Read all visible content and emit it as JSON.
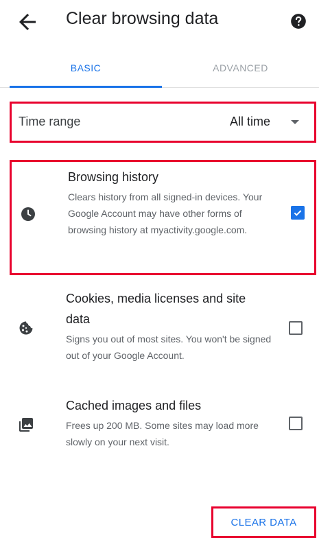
{
  "appbar": {
    "title": "Clear browsing data",
    "back_icon": "arrow-left-icon",
    "help_icon": "help-circle-icon"
  },
  "tabs": [
    {
      "label": "BASIC",
      "selected": true
    },
    {
      "label": "ADVANCED",
      "selected": false
    }
  ],
  "time_range": {
    "label": "Time range",
    "value": "All time"
  },
  "items": [
    {
      "icon": "clock-icon",
      "title": "Browsing history",
      "description": "Clears history from all signed-in devices. Your Google Account may have other forms of browsing history at myactivity.google.com.",
      "checked": true
    },
    {
      "icon": "cookie-icon",
      "title": "Cookies, media licenses and site data",
      "description": "Signs you out of most sites. You won't be signed out of your Google Account.",
      "checked": false
    },
    {
      "icon": "images-icon",
      "title": "Cached images and files",
      "description": "Frees up 200 MB. Some sites may load more slowly on your next visit.",
      "checked": false
    }
  ],
  "action": {
    "clear_label": "CLEAR DATA"
  },
  "colors": {
    "accent": "#1a73e8",
    "highlight_outline": "#e8002d"
  }
}
